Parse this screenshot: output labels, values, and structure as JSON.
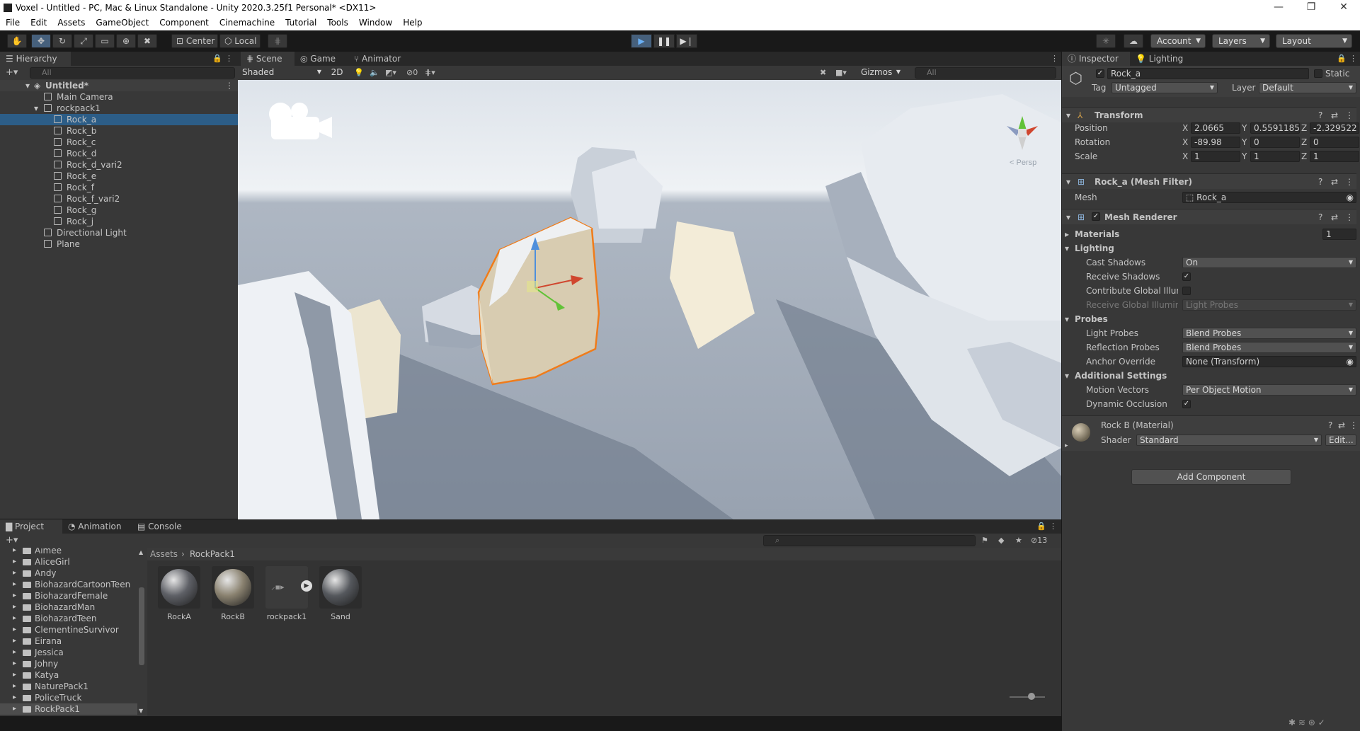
{
  "window": {
    "title": "Voxel - Untitled - PC, Mac & Linux Standalone - Unity 2020.3.25f1 Personal* <DX11>",
    "controls": [
      "—",
      "❐",
      "✕"
    ]
  },
  "menu": [
    "File",
    "Edit",
    "Assets",
    "GameObject",
    "Component",
    "Cinemachine",
    "Tutorial",
    "Tools",
    "Window",
    "Help"
  ],
  "toolbar": {
    "pivot": "Center",
    "space": "Local",
    "account": "Account",
    "layers": "Layers",
    "layout": "Layout"
  },
  "hierarchy": {
    "tab": "Hierarchy",
    "search_placeholder": "All",
    "scene": "Untitled*",
    "items": [
      {
        "label": "Main Camera",
        "depth": 1
      },
      {
        "label": "rockpack1",
        "depth": 1
      },
      {
        "label": "Rock_a",
        "depth": 2,
        "selected": true
      },
      {
        "label": "Rock_b",
        "depth": 2
      },
      {
        "label": "Rock_c",
        "depth": 2
      },
      {
        "label": "Rock_d",
        "depth": 2
      },
      {
        "label": "Rock_d_vari2",
        "depth": 2
      },
      {
        "label": "Rock_e",
        "depth": 2
      },
      {
        "label": "Rock_f",
        "depth": 2
      },
      {
        "label": "Rock_f_vari2",
        "depth": 2
      },
      {
        "label": "Rock_g",
        "depth": 2
      },
      {
        "label": "Rock_j",
        "depth": 2
      },
      {
        "label": "Directional Light",
        "depth": 1
      },
      {
        "label": "Plane",
        "depth": 1
      }
    ]
  },
  "scene": {
    "tabs": [
      "Scene",
      "Game",
      "Animator"
    ],
    "shading": "Shaded",
    "mode_2d": "2D",
    "hidden_count": "0",
    "gizmos": "Gizmos",
    "search_placeholder": "All",
    "persp": "< Persp"
  },
  "inspector": {
    "tabs": [
      "Inspector",
      "Lighting"
    ],
    "object_name": "Rock_a",
    "static": "Static",
    "tag_label": "Tag",
    "tag": "Untagged",
    "layer_label": "Layer",
    "layer": "Default",
    "transform": {
      "title": "Transform",
      "position_label": "Position",
      "rotation_label": "Rotation",
      "scale_label": "Scale",
      "position": [
        "2.0665",
        "0.5591185",
        "-2.329522"
      ],
      "rotation": [
        "-89.98",
        "0",
        "0"
      ],
      "scale": [
        "1",
        "1",
        "1"
      ],
      "axes": [
        "X",
        "Y",
        "Z"
      ]
    },
    "mesh_filter": {
      "title": "Rock_a (Mesh Filter)",
      "mesh_label": "Mesh",
      "mesh": "Rock_a"
    },
    "mesh_renderer": {
      "title": "Mesh Renderer",
      "materials_label": "Materials",
      "materials_count": "1",
      "lighting_label": "Lighting",
      "cast_shadows_label": "Cast Shadows",
      "cast_shadows": "On",
      "receive_shadows_label": "Receive Shadows",
      "contribute_gi_label": "Contribute Global Illumir",
      "receive_gi_label": "Receive Global Illuminat",
      "receive_gi": "Light Probes",
      "probes_label": "Probes",
      "light_probes_label": "Light Probes",
      "light_probes": "Blend Probes",
      "reflection_probes_label": "Reflection Probes",
      "reflection_probes": "Blend Probes",
      "anchor_override_label": "Anchor Override",
      "anchor_override": "None (Transform)",
      "additional_label": "Additional Settings",
      "motion_vectors_label": "Motion Vectors",
      "motion_vectors": "Per Object Motion",
      "dynamic_occlusion_label": "Dynamic Occlusion"
    },
    "material": {
      "title": "Rock B (Material)",
      "shader_label": "Shader",
      "shader": "Standard",
      "edit": "Edit..."
    },
    "add_component": "Add Component"
  },
  "project": {
    "tabs": [
      "Project",
      "Animation",
      "Console"
    ],
    "breadcrumb": [
      "Assets",
      "RockPack1"
    ],
    "hidden_count": "13",
    "folders": [
      "Aimee",
      "AliceGirl",
      "Andy",
      "BiohazardCartoonTeen",
      "BiohazardFemale",
      "BiohazardMan",
      "BiohazardTeen",
      "ClementineSurvivor",
      "Eirana",
      "Jessica",
      "Johny",
      "Katya",
      "NaturePack1",
      "PoliceTruck",
      "RockPack1"
    ],
    "assets": [
      {
        "label": "RockA",
        "kind": "material",
        "color": "#5e6066"
      },
      {
        "label": "RockB",
        "kind": "material",
        "color": "#8a8270"
      },
      {
        "label": "rockpack1",
        "kind": "model",
        "color": "#444"
      },
      {
        "label": "Sand",
        "kind": "material",
        "color": "#55585d"
      }
    ]
  }
}
